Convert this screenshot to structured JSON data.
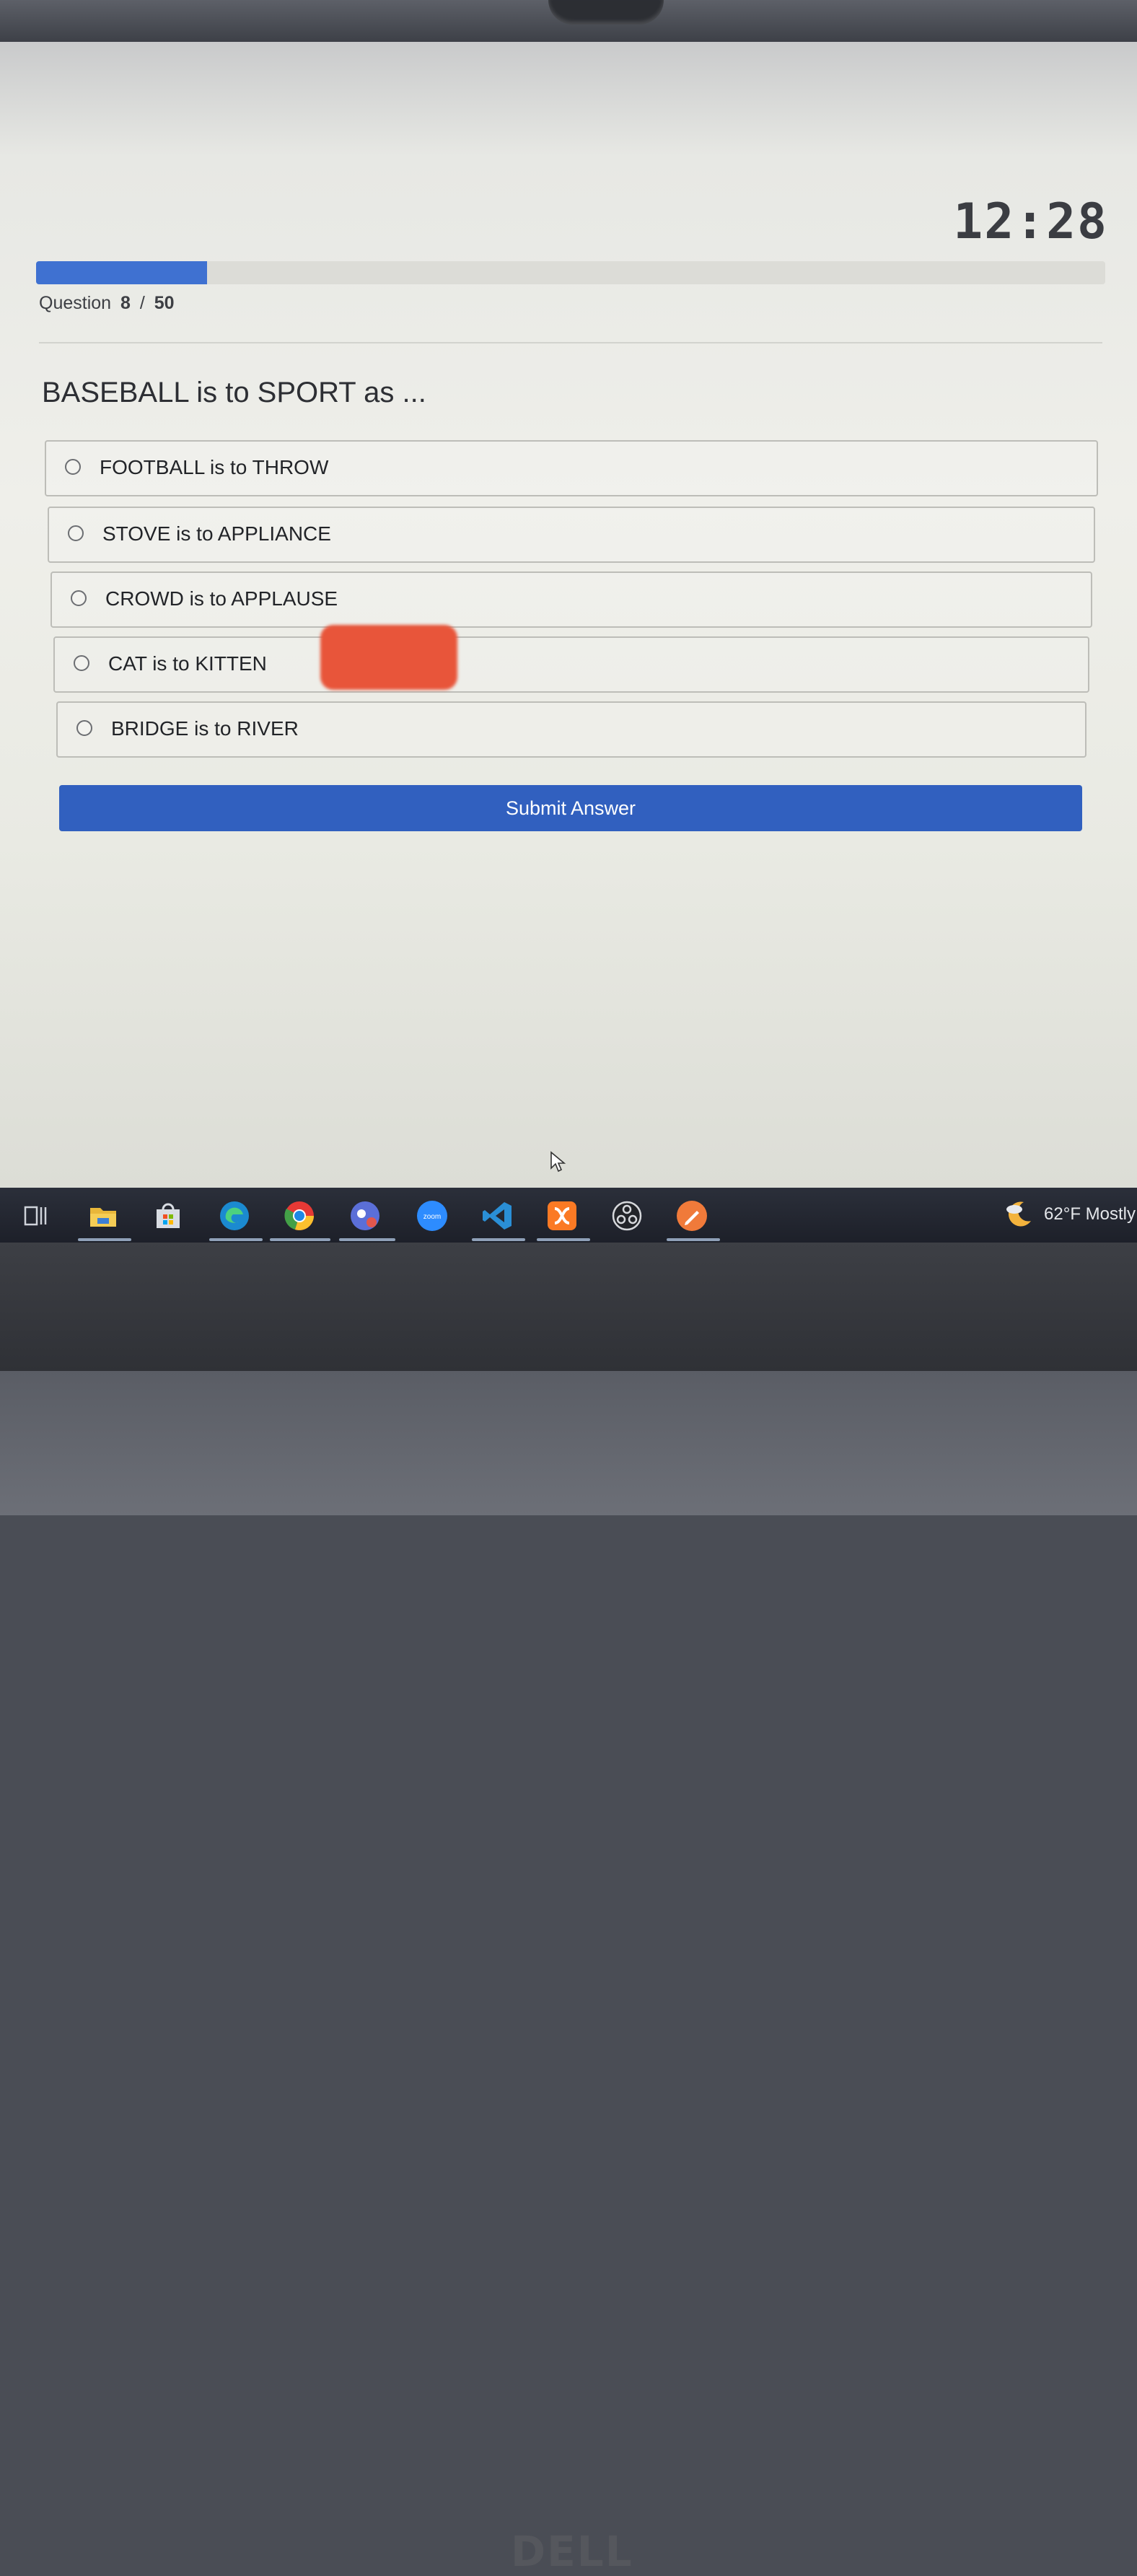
{
  "timer": "12:28",
  "progress": {
    "fraction": 0.16
  },
  "question_counter": {
    "prefix": "Question",
    "current": "8",
    "separator": "/",
    "total": "50"
  },
  "question": "BASEBALL is to SPORT as ...",
  "options": [
    {
      "label": "FOOTBALL is to THROW"
    },
    {
      "label": "STOVE is to APPLIANCE"
    },
    {
      "label": "CROWD is to APPLAUSE"
    },
    {
      "label": "CAT is to KITTEN"
    },
    {
      "label": "BRIDGE is to RIVER"
    }
  ],
  "submit_label": "Submit Answer",
  "taskbar": {
    "apps": [
      "task-view",
      "file-explorer",
      "microsoft-store",
      "edge",
      "chrome",
      "teams",
      "zoom",
      "vscode",
      "xampp",
      "obs",
      "pen-app"
    ],
    "zoom_label": "zoom",
    "weather": "62°F  Mostly"
  },
  "brand": "DELL",
  "colors": {
    "accent": "#3160bf",
    "progress": "#3f71d1",
    "redaction": "#e8553a"
  }
}
